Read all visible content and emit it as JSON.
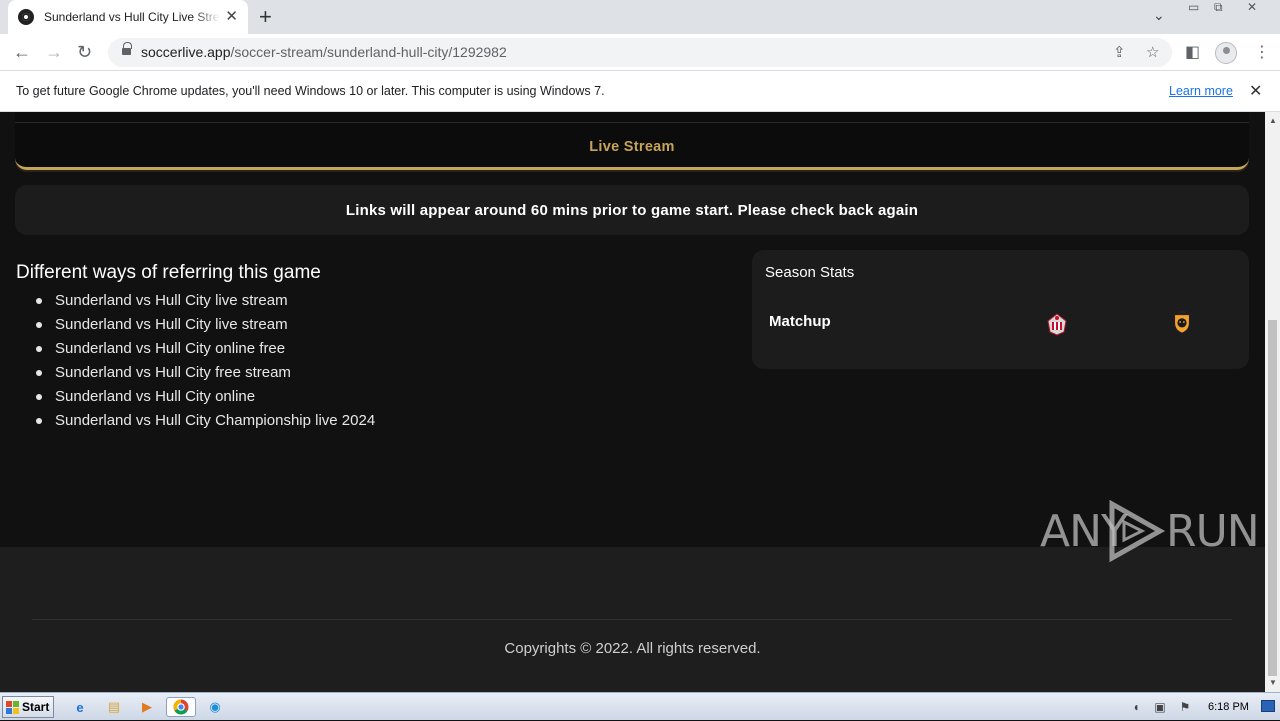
{
  "browser": {
    "tab_title": "Sunderland vs Hull City Live Streams",
    "url_domain": "soccerlive.app",
    "url_path": "/soccer-stream/sunderland-hull-city/1292982",
    "infobar_message": "To get future Google Chrome updates, you'll need Windows 10 or later. This computer is using Windows 7.",
    "infobar_link": "Learn more"
  },
  "page": {
    "stream_label": "Live Stream",
    "notice": "Links will appear around 60 mins prior to game start. Please check back again",
    "ways_title": "Different ways of referring this game",
    "ways": [
      "Sunderland vs Hull City live stream",
      "Sunderland vs Hull City live stream",
      "Sunderland vs Hull City online free",
      "Sunderland vs Hull City free stream",
      "Sunderland vs Hull City online",
      "Sunderland vs Hull City Championship live 2024"
    ],
    "stats_title": "Season Stats",
    "stats_matchup": "Matchup",
    "footer": "Copyrights © 2022. All rights reserved.",
    "watermark_left": "ANY",
    "watermark_right": "RUN"
  },
  "taskbar": {
    "start_label": "Start",
    "clock": "6:18 PM"
  },
  "colors": {
    "accent_gold": "#c6a45a",
    "page_bg": "#111111",
    "card_bg": "#1c1c1c",
    "link_blue": "#1a73e8"
  }
}
